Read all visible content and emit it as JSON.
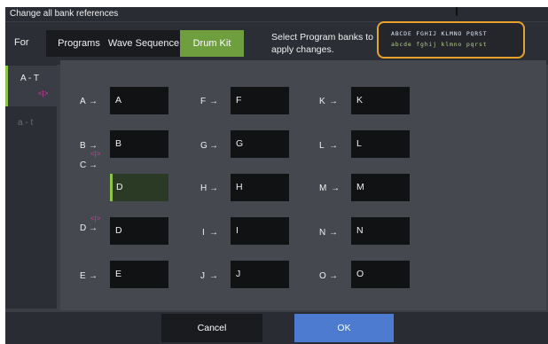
{
  "title": "Change all bank references",
  "for_label": "For",
  "tabs": [
    {
      "label": "Programs",
      "active": false
    },
    {
      "label": "Wave Sequence",
      "active": false
    },
    {
      "label": "Drum Kit",
      "active": true
    }
  ],
  "instruction": "Select Program banks to apply changes.",
  "bank_selector": {
    "upper_row": "ABCDE FGHIJ KLMNO PQRST",
    "lower_row": "abcde fghij klmno pqrst"
  },
  "side_tabs": [
    {
      "label": "A - T",
      "active": true,
      "marker": "<|>"
    },
    {
      "label": "a - t",
      "active": false
    }
  ],
  "mappings": [
    {
      "source": "A",
      "arrow": "→",
      "target": "A"
    },
    {
      "source": "B",
      "arrow": "→",
      "target": "B"
    },
    {
      "source": "C",
      "arrow": "→",
      "target": "D",
      "edited": true,
      "marker": "<|>"
    },
    {
      "source": "D",
      "arrow": "→",
      "target": "D",
      "marker": "<|>"
    },
    {
      "source": "E",
      "arrow": "→",
      "target": "E"
    },
    {
      "source": "F",
      "arrow": "→",
      "target": "F"
    },
    {
      "source": "G",
      "arrow": "→",
      "target": "G"
    },
    {
      "source": "H",
      "arrow": "→",
      "target": "H"
    },
    {
      "source": "I",
      "arrow": "→",
      "target": "I"
    },
    {
      "source": "J",
      "arrow": "→",
      "target": "J"
    },
    {
      "source": "K",
      "arrow": "→",
      "target": "K"
    },
    {
      "source": "L",
      "arrow": "→",
      "target": "L"
    },
    {
      "source": "M",
      "arrow": "→",
      "target": "M"
    },
    {
      "source": "N",
      "arrow": "→",
      "target": "N"
    },
    {
      "source": "O",
      "arrow": "→",
      "target": "O"
    }
  ],
  "buttons": {
    "cancel": "Cancel",
    "ok": "OK"
  },
  "colors": {
    "accent_green": "#6e9e3e",
    "highlight_orange": "#e8a22a",
    "ok_blue": "#4d7bd0",
    "marker_magenta": "#d23ca0"
  }
}
